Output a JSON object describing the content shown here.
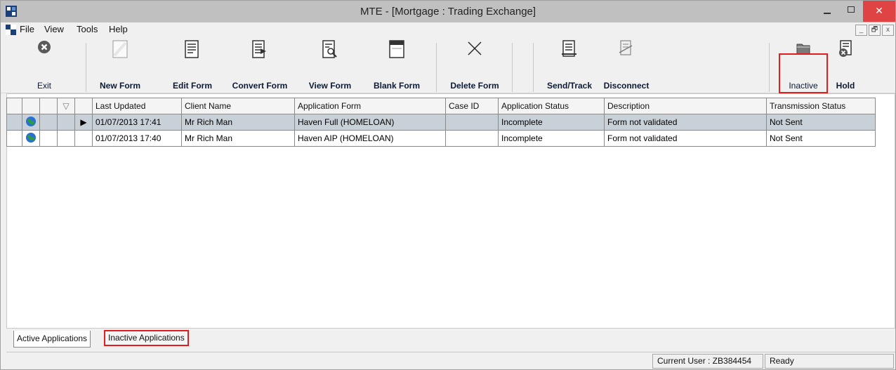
{
  "window": {
    "title": "MTE - [Mortgage : Trading Exchange]",
    "close_glyph": "✕"
  },
  "menu": {
    "items": [
      "File",
      "View",
      "Tools",
      "Help"
    ],
    "mdi": [
      "_",
      "🗗",
      "x"
    ]
  },
  "toolbar": {
    "buttons": [
      {
        "label": "Exit",
        "icon": "exit-icon"
      },
      {
        "label": "New Form",
        "icon": "new-form-icon"
      },
      {
        "label": "Edit Form",
        "icon": "edit-form-icon"
      },
      {
        "label": "Convert Form",
        "icon": "convert-form-icon"
      },
      {
        "label": "View Form",
        "icon": "view-form-icon"
      },
      {
        "label": "Blank Form",
        "icon": "blank-form-icon"
      },
      {
        "label": "Delete Form",
        "icon": "delete-form-icon"
      },
      {
        "label": "Send/Track",
        "icon": "send-track-icon"
      },
      {
        "label": "Disconnect",
        "icon": "disconnect-icon"
      },
      {
        "label": "Inactive",
        "icon": "inactive-folder-icon"
      },
      {
        "label": "Hold",
        "icon": "hold-icon"
      }
    ]
  },
  "grid": {
    "sort_glyph": "▽",
    "row_pointer": "▶",
    "columns": [
      "Last Updated",
      "Client Name",
      "Application Form",
      "Case ID",
      "Application Status",
      "Description",
      "Transmission Status"
    ],
    "rows": [
      {
        "last_updated": "01/07/2013 17:41",
        "client_name": "Mr Rich Man",
        "application_form": "Haven Full (HOMELOAN)",
        "case_id": "",
        "application_status": "Incomplete",
        "description": "Form not validated",
        "transmission_status": "Not Sent",
        "selected": true
      },
      {
        "last_updated": "01/07/2013 17:40",
        "client_name": "Mr Rich Man",
        "application_form": "Haven AIP (HOMELOAN)",
        "case_id": "",
        "application_status": "Incomplete",
        "description": "Form not validated",
        "transmission_status": "Not Sent",
        "selected": false
      }
    ]
  },
  "tabs": {
    "active_label": "Active Applications",
    "inactive_label": "Inactive Applications"
  },
  "status": {
    "user": "Current User : ZB384454",
    "state": "Ready"
  },
  "colors": {
    "highlight": "#e01e1e",
    "selected_row": "#c9d1d8",
    "close_button": "#e04343"
  }
}
